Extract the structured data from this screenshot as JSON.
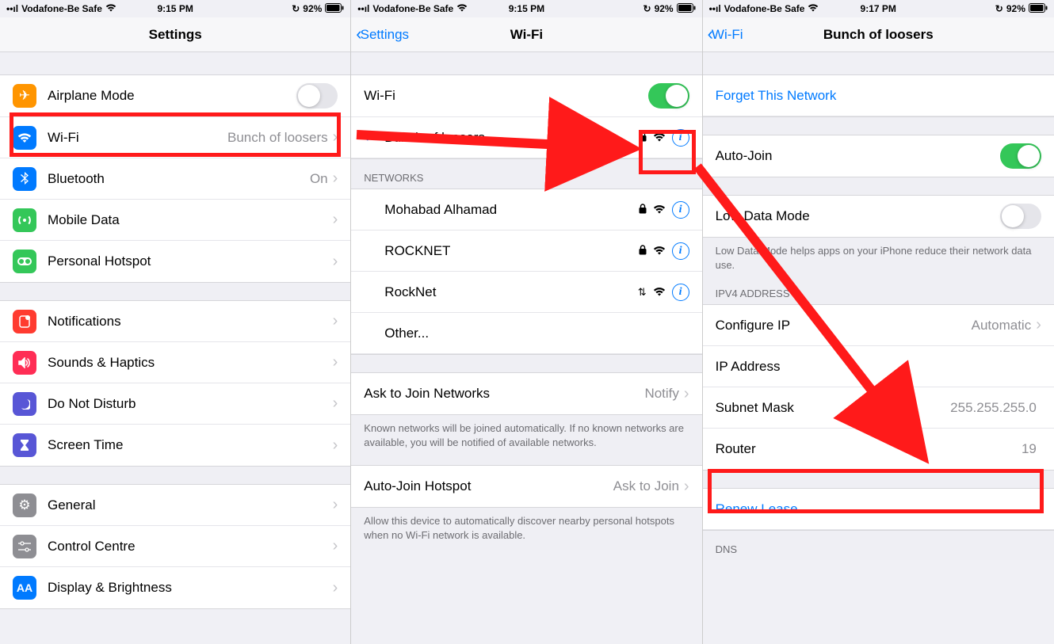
{
  "status": {
    "carrier": "Vodafone-Be Safe",
    "time1": "9:15 PM",
    "time3": "9:17 PM",
    "battery": "92%"
  },
  "pane1": {
    "title": "Settings",
    "rows": {
      "airplane": "Airplane Mode",
      "wifi": "Wi-Fi",
      "wifi_value": "Bunch of loosers",
      "bluetooth": "Bluetooth",
      "bluetooth_value": "On",
      "mobile": "Mobile Data",
      "hotspot": "Personal Hotspot",
      "notifications": "Notifications",
      "sounds": "Sounds & Haptics",
      "dnd": "Do Not Disturb",
      "screentime": "Screen Time",
      "general": "General",
      "controlcentre": "Control Centre",
      "display": "Display & Brightness"
    }
  },
  "pane2": {
    "back": "Settings",
    "title": "Wi-Fi",
    "wifi_toggle_label": "Wi-Fi",
    "connected": "Bunch of loosers",
    "networks_header": "NETWORKS",
    "networks": [
      "Mohabad Alhamad",
      "ROCKNET",
      "RockNet",
      "Other..."
    ],
    "ask_label": "Ask to Join Networks",
    "ask_value": "Notify",
    "ask_footer": "Known networks will be joined automatically. If no known networks are available, you will be notified of available networks.",
    "autojoin_label": "Auto-Join Hotspot",
    "autojoin_value": "Ask to Join",
    "autojoin_footer": "Allow this device to automatically discover nearby personal hotspots when no Wi-Fi network is available."
  },
  "pane3": {
    "back": "Wi-Fi",
    "title": "Bunch of loosers",
    "forget": "Forget This Network",
    "autojoin": "Auto-Join",
    "lowdata": "Low Data Mode",
    "lowdata_footer": "Low Data Mode helps apps on your iPhone reduce their network data use.",
    "ipv4_header": "IPV4 ADDRESS",
    "configure_ip": "Configure IP",
    "configure_ip_value": "Automatic",
    "ipaddress": "IP Address",
    "subnet": "Subnet Mask",
    "subnet_value": "255.255.255.0",
    "router": "Router",
    "router_value": "19",
    "renew": "Renew Lease",
    "dns_header": "DNS"
  }
}
